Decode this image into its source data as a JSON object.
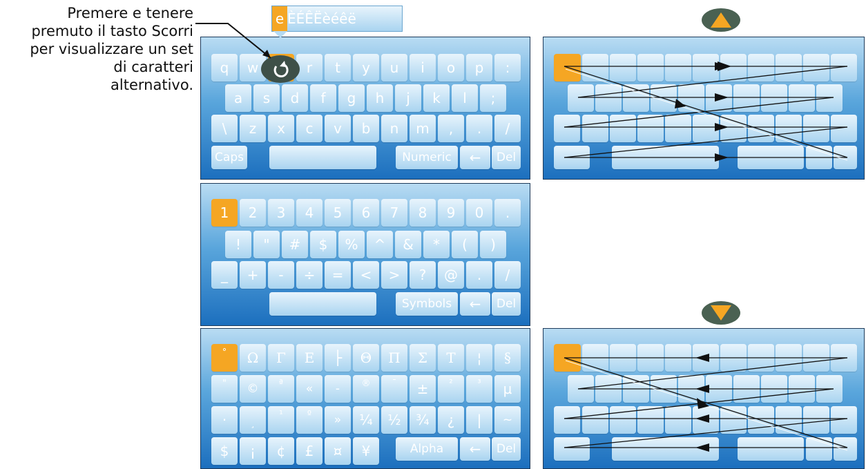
{
  "callout": {
    "lines": [
      "Premere e tenere",
      "premuto il tasto Scorri",
      "per visualizzare un set",
      "di caratteri",
      "alternativo."
    ]
  },
  "popup": {
    "first": "e",
    "rest": "ÈÉÊËèéêë"
  },
  "alpha_keyboard": {
    "row1": [
      "q",
      "w",
      "e",
      "r",
      "t",
      "y",
      "u",
      "i",
      "o",
      "p",
      ":"
    ],
    "row2": [
      "a",
      "s",
      "d",
      "f",
      "g",
      "h",
      "j",
      "k",
      "l",
      ";"
    ],
    "row3": [
      "\\",
      "z",
      "x",
      "c",
      "v",
      "b",
      "n",
      "m",
      ",",
      ".",
      "/"
    ],
    "caps": "Caps",
    "mode": "Numeric",
    "backspace": "←",
    "del": "Del"
  },
  "numeric_keyboard": {
    "row1": [
      "1",
      "2",
      "3",
      "4",
      "5",
      "6",
      "7",
      "8",
      "9",
      "0",
      "."
    ],
    "row2": [
      "!",
      "\"",
      "#",
      "$",
      "%",
      "^",
      "&",
      "*",
      "(",
      ")"
    ],
    "row3": [
      "_",
      "+",
      "-",
      "÷",
      "=",
      "<",
      ">",
      "?",
      "@",
      ".",
      "/"
    ],
    "mode": "Symbols",
    "backspace": "←",
    "del": "Del"
  },
  "symbols_keyboard": {
    "row1": [
      "°",
      "Ω",
      "Γ",
      "Ε",
      "├",
      "Θ",
      "Π",
      "Σ",
      "Τ",
      "¦",
      "§"
    ],
    "row2": [
      "\"",
      "©",
      "ª",
      "«",
      "-",
      "®",
      "¯",
      "±",
      "²",
      "³",
      "µ"
    ],
    "row3": [
      "·",
      "¸",
      "¹",
      "º",
      "»",
      "¼",
      "½",
      "¾",
      "¿",
      "|",
      "~"
    ],
    "row4": [
      "$",
      "¡",
      "¢",
      "£",
      "¤",
      "¥"
    ],
    "mode": "Alpha",
    "backspace": "←",
    "del": "Del"
  },
  "icons": {
    "scroll": "scroll-icon",
    "up": "arrow-up-icon",
    "down": "arrow-down-icon"
  },
  "colors": {
    "highlight": "#f5a623",
    "key": "#a9d4f0",
    "panel": "#1c6fbe",
    "oval": "#4a6152"
  }
}
